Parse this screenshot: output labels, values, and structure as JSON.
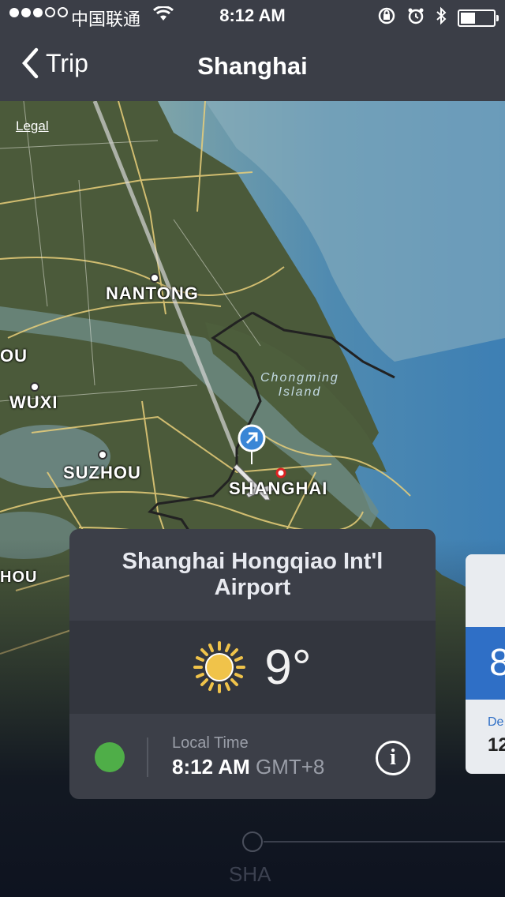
{
  "status_bar": {
    "carrier": "中国联通",
    "time": "8:12 AM"
  },
  "nav": {
    "back_label": "Trip",
    "title": "Shanghai"
  },
  "map": {
    "legal_label": "Legal",
    "cities": {
      "nantong": "NANTONG",
      "ou": "OU",
      "wuxi": "WUXI",
      "suzhou": "SUZHOU",
      "shanghai": "SHANGHAI",
      "hou": "HOU"
    },
    "island_line1": "Chongming",
    "island_line2": "Island"
  },
  "airport_card": {
    "name": "Shanghai Hongqiao Int'l Airport",
    "weather_icon": "sun-icon",
    "temperature": "9°",
    "local_time_label": "Local Time",
    "local_time": "8:12 AM",
    "timezone": "GMT+8",
    "status_color": "#4fae48"
  },
  "next_card": {
    "big_digit": "8",
    "label": "De",
    "value": "12"
  },
  "timeline": {
    "airport_code": "SHA"
  }
}
